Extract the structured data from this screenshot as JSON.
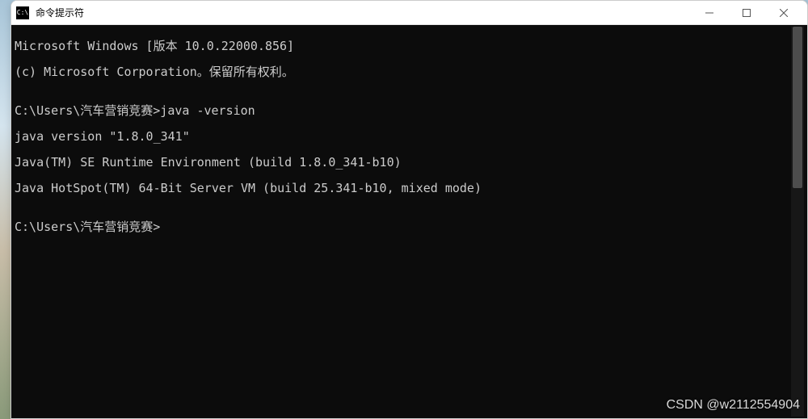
{
  "window": {
    "title": "命令提示符",
    "icon_label": "C:\\"
  },
  "terminal": {
    "lines": [
      "Microsoft Windows [版本 10.0.22000.856]",
      "(c) Microsoft Corporation。保留所有权利。",
      "",
      "C:\\Users\\汽车营销竞赛>java -version",
      "java version \"1.8.0_341\"",
      "Java(TM) SE Runtime Environment (build 1.8.0_341-b10)",
      "Java HotSpot(TM) 64-Bit Server VM (build 25.341-b10, mixed mode)",
      "",
      "C:\\Users\\汽车营销竞赛>"
    ]
  },
  "watermark": "CSDN @w2112554904"
}
